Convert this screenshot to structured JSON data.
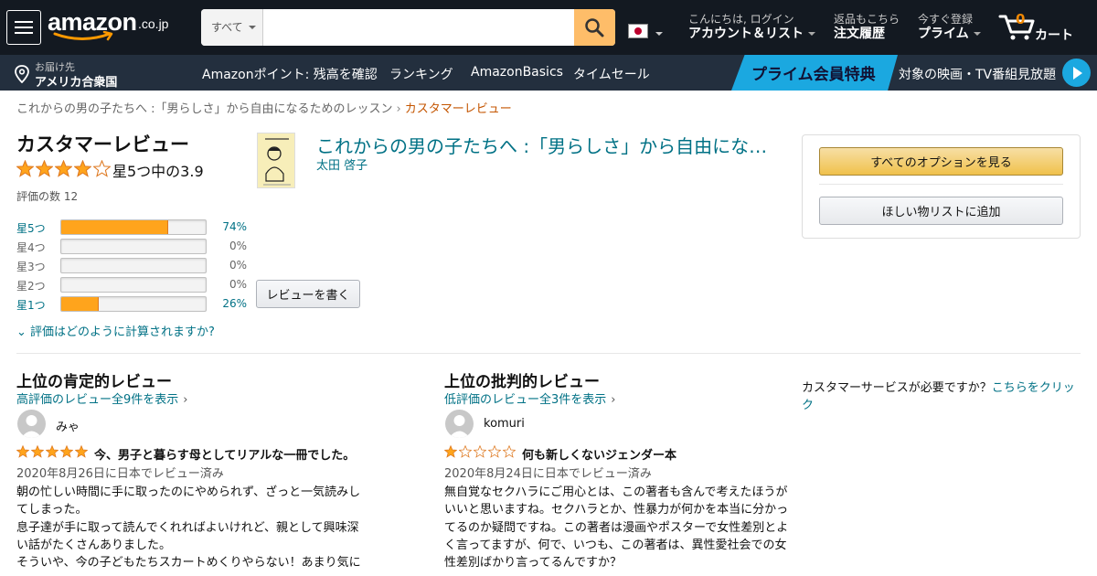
{
  "header": {
    "logo_text": "amazon",
    "logo_tld": ".co.jp",
    "search": {
      "category": "すべて",
      "placeholder": ""
    },
    "account": {
      "line1": "こんにちは, ログイン",
      "line2": "アカウント＆リスト"
    },
    "orders": {
      "line1": "返品もこちら",
      "line2": "注文履歴"
    },
    "prime": {
      "line1": "今すぐ登録",
      "line2": "プライム"
    },
    "cart": {
      "count": "0",
      "label": "カート"
    }
  },
  "subnav": {
    "deliver_line1": "お届け先",
    "deliver_line2": "アメリカ合衆国",
    "links": [
      "Amazonポイント: 残高を確認",
      "ランキング",
      "AmazonBasics",
      "タイムセール"
    ],
    "prime_banner_title": "プライム会員特典",
    "prime_banner_sub": "対象の映画・TV番組見放題"
  },
  "breadcrumb": {
    "book": "これからの男の子たちへ :「男らしさ」から自由になるためのレッスン",
    "current": "カスタマーレビュー"
  },
  "summary": {
    "heading": "カスタマーレビュー",
    "rating": 3.9,
    "rating_text": "星5つ中の3.9",
    "count_text": "評価の数 12",
    "histogram": [
      {
        "label": "星5つ",
        "percent": 74,
        "percent_text": "74%",
        "active": true
      },
      {
        "label": "星4つ",
        "percent": 0,
        "percent_text": "0%",
        "active": false
      },
      {
        "label": "星3つ",
        "percent": 0,
        "percent_text": "0%",
        "active": false
      },
      {
        "label": "星2つ",
        "percent": 0,
        "percent_text": "0%",
        "active": false
      },
      {
        "label": "星1つ",
        "percent": 26,
        "percent_text": "26%",
        "active": true
      }
    ],
    "how_calculated": "評価はどのように計算されますか?"
  },
  "product": {
    "title": "これからの男の子たちへ :「男らしさ」から自由になるためのレッスン",
    "author": "太田 啓子",
    "write_review": "レビューを書く"
  },
  "sidebox": {
    "all_options": "すべてのオプションを見る",
    "wishlist": "ほしい物リストに追加"
  },
  "positive": {
    "heading": "上位の肯定的レビュー",
    "link": "高評価のレビュー全9件を表示",
    "reviewer": "みゃ",
    "stars": 5,
    "headline": "今、男子と暮らす母としてリアルな一冊でした。",
    "date": "2020年8月26日に日本でレビュー済み",
    "body": [
      "朝の忙しい時間に手に取ったのにやめられず、ざっと一気読みし",
      "てしまった。",
      "息子達が手に取って読んでくれればよいけれど、親として興味深",
      "い話がたくさんありました。",
      "そういや、今の子どもたちスカートめくりやらない！あまり気に"
    ]
  },
  "critical": {
    "heading": "上位の批判的レビュー",
    "link": "低評価のレビュー全3件を表示",
    "reviewer": "komuri",
    "stars": 1,
    "headline": "何も新しくないジェンダー本",
    "date": "2020年8月24日に日本でレビュー済み",
    "body": [
      "無自覚なセクハラにご用心とは、この著者も含んで考えたほうが",
      "いいと思いますね。セクハラとか、性暴力が何かを本当に分かっ",
      "てるのか疑問ですね。この著者は漫画やポスターで女性差別とよ",
      "く言ってますが、何で、いつも、この著者は、異性愛社会での女",
      "性差別ばかり言ってるんですか？"
    ]
  },
  "customer_service": {
    "text": "カスタマーサービスが必要ですか？",
    "link": "こちらをクリック"
  },
  "colors": {
    "nav_bg": "#131921",
    "subnav_bg": "#232f3e",
    "search_button": "#febd69",
    "link": "#007185",
    "star": "#ffa41c",
    "cart_count": "#f08804",
    "prime_blue": "#1ba8e0"
  }
}
